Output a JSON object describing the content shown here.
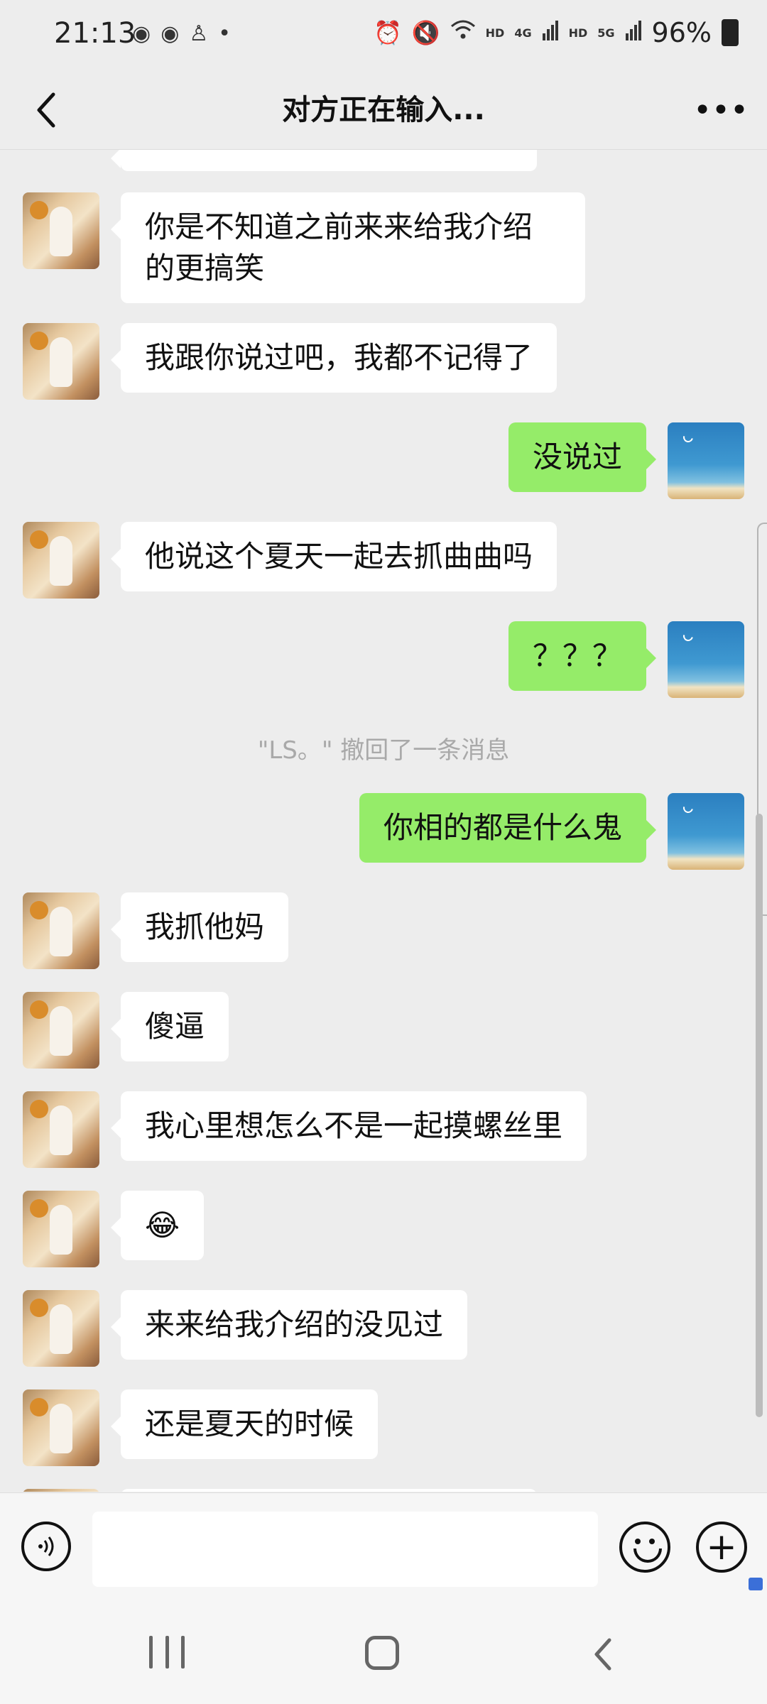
{
  "status_bar": {
    "time": "21:13",
    "left_icons": [
      "weibo-icon",
      "weibo-icon",
      "app-icon",
      "dot-icon"
    ],
    "hd1": "HD",
    "net1": "4G",
    "hd2": "HD",
    "net2": "5G",
    "battery": "96%"
  },
  "header": {
    "title": "对方正在输入..."
  },
  "messages": [
    {
      "side": "in",
      "text": "你是不知道之前来来给我介绍的更搞笑"
    },
    {
      "side": "in",
      "text": "我跟你说过吧，我都不记得了"
    },
    {
      "side": "out",
      "text": "没说过"
    },
    {
      "side": "in",
      "text": "他说这个夏天一起去抓曲曲吗"
    },
    {
      "side": "out",
      "text": "？？？"
    },
    {
      "side": "system",
      "text": "\"LS。\" 撤回了一条消息"
    },
    {
      "side": "out",
      "text": "你相的都是什么鬼"
    },
    {
      "side": "in",
      "text": "我抓他妈"
    },
    {
      "side": "in",
      "text": "傻逼"
    },
    {
      "side": "in",
      "text": "我心里想怎么不是一起摸螺丝里"
    },
    {
      "side": "in",
      "text": "😂"
    },
    {
      "side": "in",
      "text": "来来给我介绍的没见过"
    },
    {
      "side": "in",
      "text": "还是夏天的时候"
    }
  ],
  "input": {
    "value": "",
    "placeholder": ""
  },
  "colors": {
    "background": "#ededed",
    "outgoing_bubble": "#95ec69",
    "incoming_bubble": "#ffffff"
  }
}
